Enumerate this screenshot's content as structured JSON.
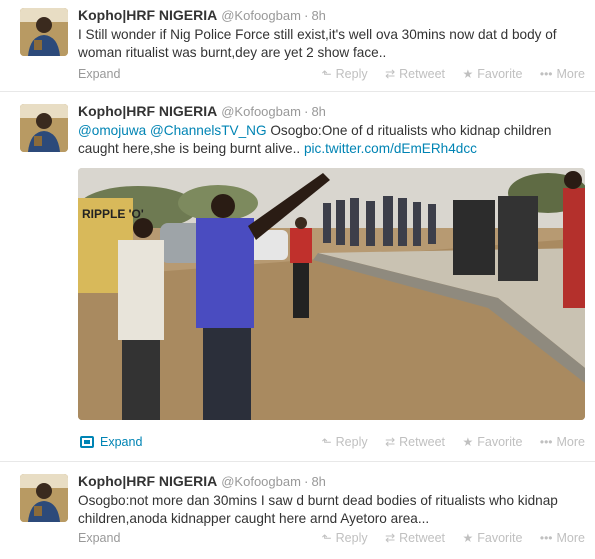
{
  "tweets": [
    {
      "fullname": "Kopho|HRF NIGERIA",
      "username": "@Kofoogbam",
      "time": "8h",
      "text": "I Still wonder if Nig Police Force still exist,it's well ova 30mins now dat d body of woman ritualist was burnt,dey are yet 2 show face..",
      "expand": "Expand"
    },
    {
      "fullname": "Kopho|HRF NIGERIA",
      "username": "@Kofoogbam",
      "time": "8h",
      "mention1": "@omojuwa",
      "mention2": "@ChannelsTV_NG",
      "text": " Osogbo:One of d ritualists who kidnap children caught here,she is being burnt alive.. ",
      "link": "pic.twitter.com/dEmERh4dcc",
      "expand": "Expand"
    },
    {
      "fullname": "Kopho|HRF NIGERIA",
      "username": "@Kofoogbam",
      "time": "8h",
      "text": "Osogbo:not more dan 30mins I saw d burnt dead bodies of ritualists who kidnap children,anoda kidnapper caught here arnd Ayetoro area...",
      "expand": "Expand"
    }
  ],
  "actions": {
    "reply": "Reply",
    "retweet": "Retweet",
    "favorite": "Favorite",
    "more": "More"
  },
  "icons": {
    "reply": "reply-icon",
    "retweet": "retweet-icon",
    "favorite": "favorite-icon",
    "more": "more-icon",
    "media": "media-icon"
  },
  "photo": {
    "sign_text": "RIPPLE 'O'"
  },
  "colors": {
    "link": "#0084b4",
    "muted": "#999999",
    "action": "#c0c0c0"
  }
}
